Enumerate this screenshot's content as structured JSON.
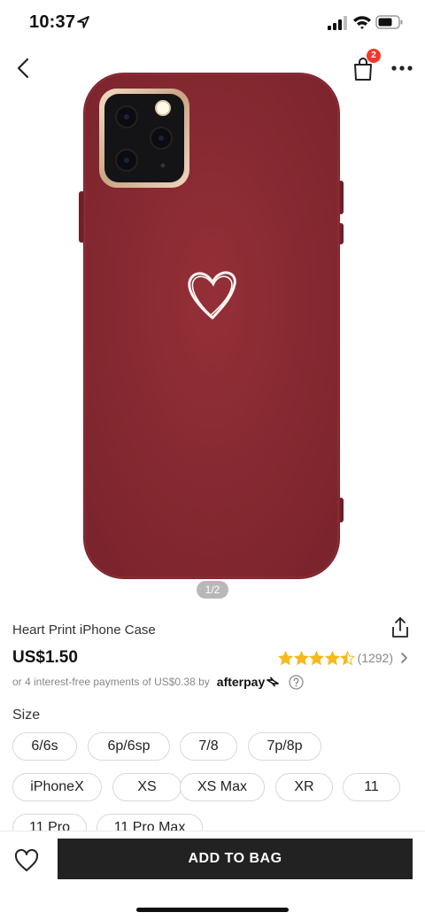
{
  "status_bar": {
    "time": "10:37"
  },
  "header": {
    "bag_count": "2"
  },
  "gallery": {
    "page_indicator": "1/2",
    "current": 1,
    "total": 2
  },
  "product": {
    "title": "Heart Print iPhone Case",
    "price": "US$1.50",
    "rating": 4.5,
    "review_count": "(1292)",
    "afterpay_text": "or 4 interest-free payments of US$0.38 by",
    "afterpay_brand": "afterpay"
  },
  "size": {
    "label": "Size",
    "options": [
      "6/6s",
      "6p/6sp",
      "7/8",
      "7p/8p",
      "iPhoneX",
      "XS",
      "XS Max",
      "XR",
      "11",
      "11 Pro",
      "11 Pro Max"
    ]
  },
  "actions": {
    "add_to_bag": "ADD TO BAG"
  },
  "colors": {
    "case": "#8a2b33",
    "button": "#222222",
    "badge": "#f0382b",
    "star": "#f6b91c"
  }
}
